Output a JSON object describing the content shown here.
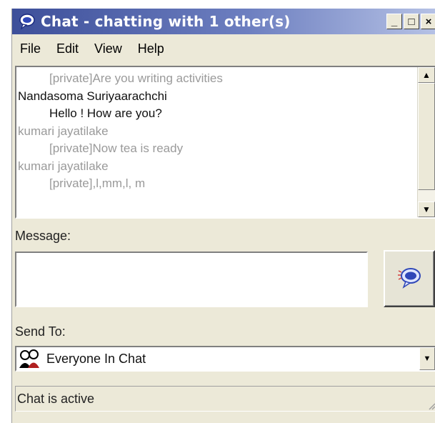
{
  "window": {
    "title": "Chat - chatting with 1 other(s)",
    "controls": {
      "minimize": "_",
      "maximize": "□",
      "close": "×"
    }
  },
  "menu": [
    "File",
    "Edit",
    "View",
    "Help"
  ],
  "chat_log": [
    {
      "text": "[private]Are you writing activities",
      "indent": true,
      "style": "gray"
    },
    {
      "text": "Nandasoma Suriyaarachchi",
      "indent": false,
      "style": "black"
    },
    {
      "text": "Hello ! How are you?",
      "indent": true,
      "style": "black"
    },
    {
      "text": "kumari jayatilake",
      "indent": false,
      "style": "gray"
    },
    {
      "text": "[private]Now tea is ready",
      "indent": true,
      "style": "gray"
    },
    {
      "text": "kumari jayatilake",
      "indent": false,
      "style": "gray"
    },
    {
      "text": "[private],l,mm,l, m",
      "indent": true,
      "style": "gray"
    }
  ],
  "message": {
    "label": "Message:",
    "value": ""
  },
  "send_button_icon": "chat-bubble-send-icon",
  "send_to": {
    "label": "Send To:",
    "value": "Everyone In Chat",
    "icon": "people-icon"
  },
  "status": {
    "text": "Chat is active"
  },
  "colors": {
    "title_start": "#3d4f9a",
    "title_end": "#b7c3e6",
    "face": "#ece9d8",
    "accent": "#2f47b8"
  }
}
